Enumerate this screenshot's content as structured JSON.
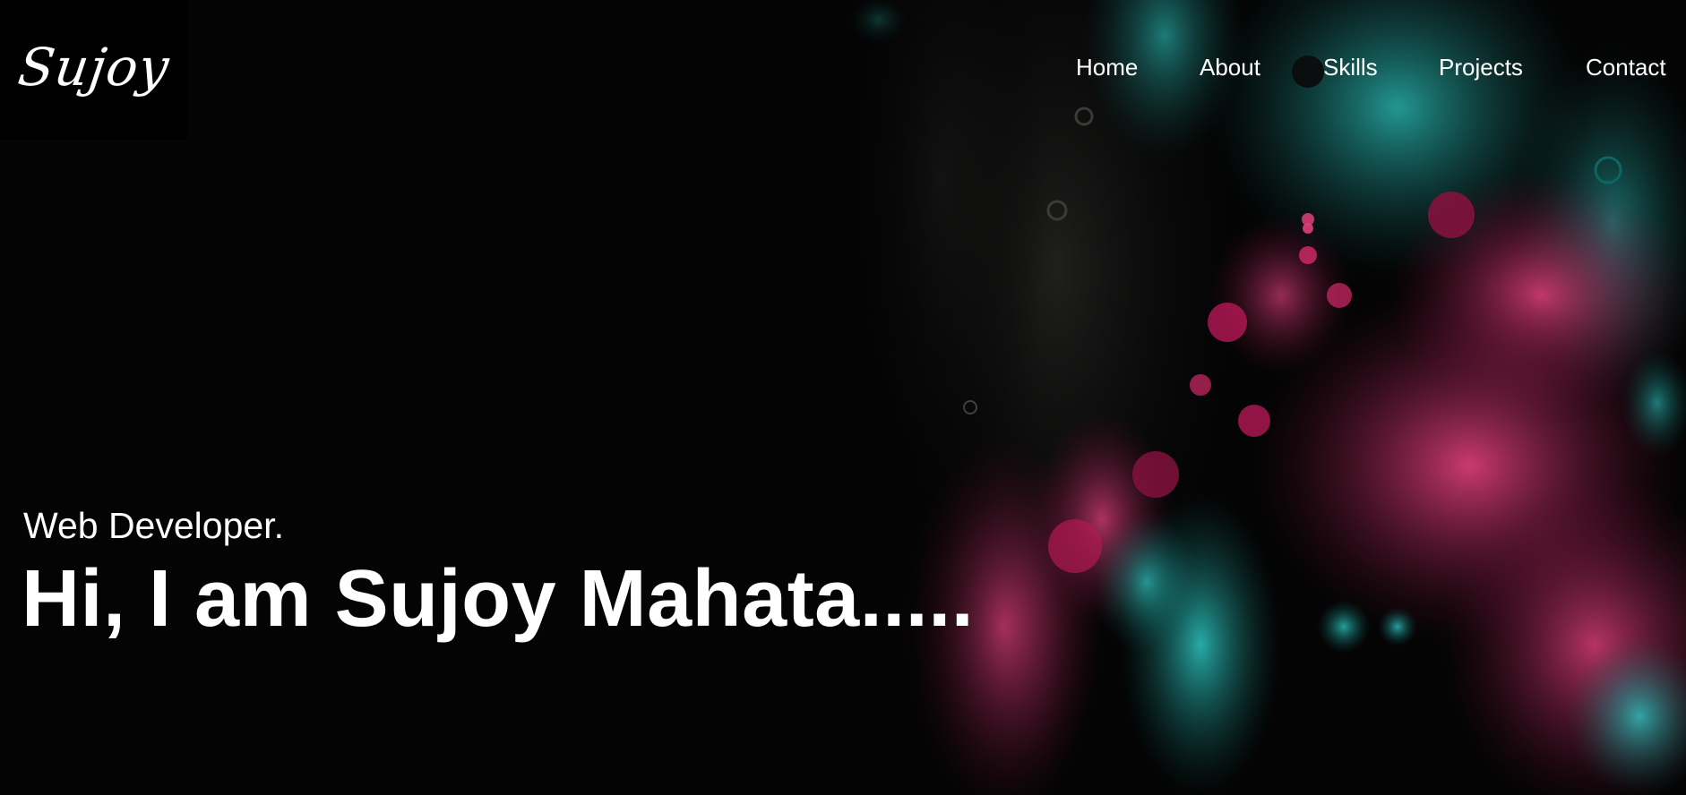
{
  "brand": {
    "logo_text": "Sujoy"
  },
  "nav": {
    "items": [
      {
        "label": "Home"
      },
      {
        "label": "About"
      },
      {
        "label": "Skills"
      },
      {
        "label": "Projects"
      },
      {
        "label": "Contact"
      }
    ]
  },
  "hero": {
    "subtitle": "Web Developer.",
    "headline": "Hi, I am Sujoy Mahata....."
  },
  "colors": {
    "background": "#040404",
    "text": "#ffffff",
    "accent_teal": "#1fb6b3",
    "accent_magenta": "#c2185b"
  }
}
